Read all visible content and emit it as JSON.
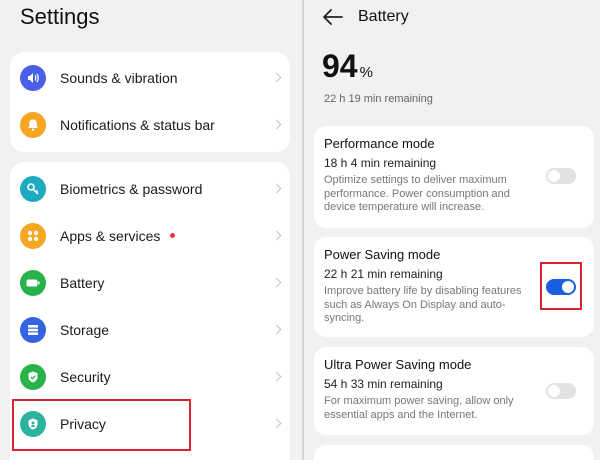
{
  "settings": {
    "title": "Settings",
    "groups": [
      {
        "items": [
          {
            "label": "Sounds & vibration",
            "icon": "speaker-icon",
            "color": "#4a5fe8"
          },
          {
            "label": "Notifications & status bar",
            "icon": "bell-icon",
            "color": "#f5a623"
          }
        ]
      },
      {
        "items": [
          {
            "label": "Biometrics & password",
            "icon": "key-icon",
            "color": "#1eaac0"
          },
          {
            "label": "Apps & services",
            "icon": "apps-grid-icon",
            "color": "#f5a623",
            "badge": true
          },
          {
            "label": "Battery",
            "icon": "battery-icon",
            "color": "#27b34a"
          },
          {
            "label": "Storage",
            "icon": "storage-icon",
            "color": "#3465e0"
          },
          {
            "label": "Security",
            "icon": "shield-check-icon",
            "color": "#27b34a"
          },
          {
            "label": "Privacy",
            "icon": "privacy-shield-icon",
            "color": "#2bb3a0"
          }
        ]
      }
    ]
  },
  "battery": {
    "title": "Battery",
    "percent": "94",
    "percent_sign": "%",
    "remaining": "22 h 19 min remaining",
    "modes": [
      {
        "title": "Performance mode",
        "subtitle": "18 h 4 min remaining",
        "description": "Optimize settings to deliver maximum performance. Power consumption and device temperature will increase.",
        "enabled": false
      },
      {
        "title": "Power Saving mode",
        "subtitle": "22 h 21 min remaining",
        "description": "Improve battery life by disabling features such as Always On Display and auto-syncing.",
        "enabled": true
      },
      {
        "title": "Ultra Power Saving mode",
        "subtitle": "54 h 33 min remaining",
        "description": "For maximum power saving, allow only essential apps and the Internet.",
        "enabled": false
      }
    ]
  },
  "colors": {
    "accent": "#1a5fe0",
    "highlight": "#d9232e",
    "badge": "#e53935"
  }
}
